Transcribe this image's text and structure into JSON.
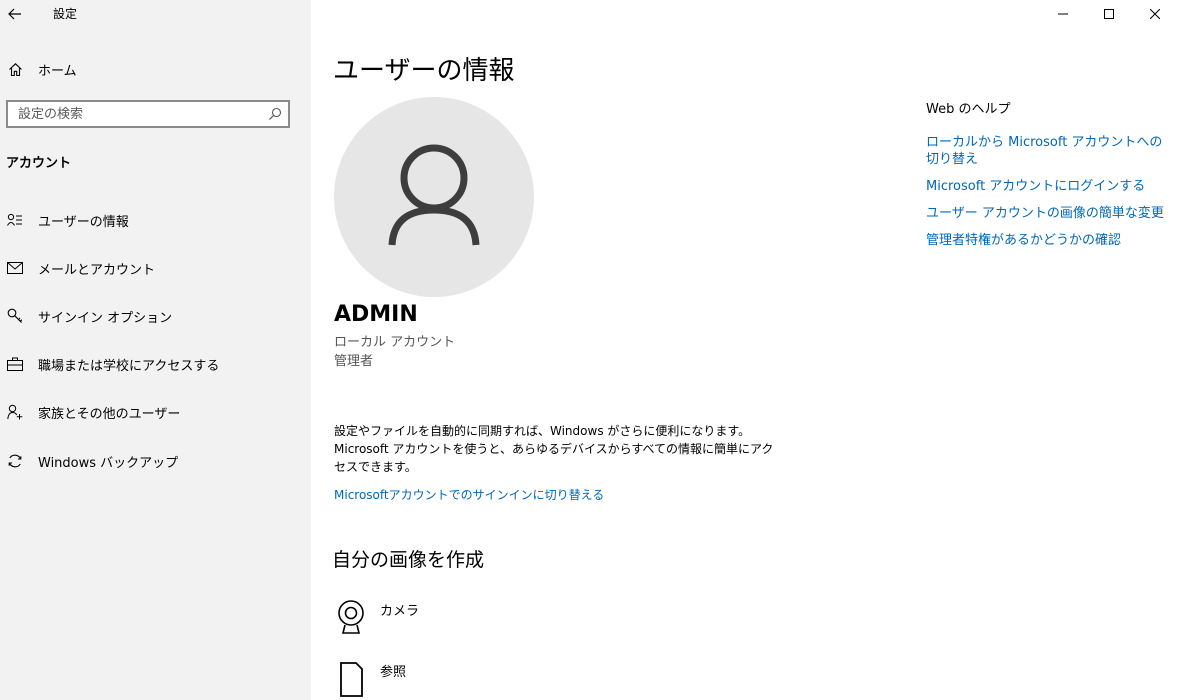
{
  "window": {
    "title": "設定",
    "back_icon": "back-arrow-icon",
    "controls": [
      "minimize-icon",
      "maximize-icon",
      "close-icon"
    ]
  },
  "sidebar": {
    "home_label": "ホーム",
    "home_icon": "home-icon",
    "search_placeholder": "設定の検索",
    "search_icon": "search-icon",
    "section_title": "アカウント",
    "items": [
      {
        "label": "ユーザーの情報",
        "icon": "user-info-icon"
      },
      {
        "label": "メールとアカウント",
        "icon": "mail-icon"
      },
      {
        "label": "サインイン オプション",
        "icon": "key-icon"
      },
      {
        "label": "職場または学校にアクセスする",
        "icon": "briefcase-icon"
      },
      {
        "label": "家族とその他のユーザー",
        "icon": "person-add-icon"
      },
      {
        "label": "Windows バックアップ",
        "icon": "sync-icon"
      }
    ]
  },
  "main": {
    "title": "ユーザーの情報",
    "avatar_icon": "person-icon",
    "user_name": "ADMIN",
    "account_type": "ローカル アカウント",
    "account_role": "管理者",
    "sync_line1": "設定やファイルを自動的に同期すれば、Windows がさらに便利になります。",
    "sync_line2": "Microsoft アカウントを使うと、あらゆるデバイスからすべての情報に簡単にアクセスできます。",
    "switch_link": "Microsoftアカウントでのサインインに切り替える",
    "create_title": "自分の画像を作成",
    "create_options": [
      {
        "label": "カメラ",
        "icon": "camera-icon"
      },
      {
        "label": "参照",
        "icon": "browse-icon"
      }
    ]
  },
  "help": {
    "title": "Web のヘルプ",
    "links": [
      "ローカルから Microsoft アカウントへの切り替え",
      "Microsoft アカウントにログインする",
      "ユーザー アカウントの画像の簡単な変更",
      "管理者特権があるかどうかの確認"
    ]
  },
  "colors": {
    "sidebar_bg": "#f2f2f2",
    "link": "#0067b8",
    "avatar_bg": "#e6e6e6",
    "avatar_fg": "#3d3d3d"
  }
}
